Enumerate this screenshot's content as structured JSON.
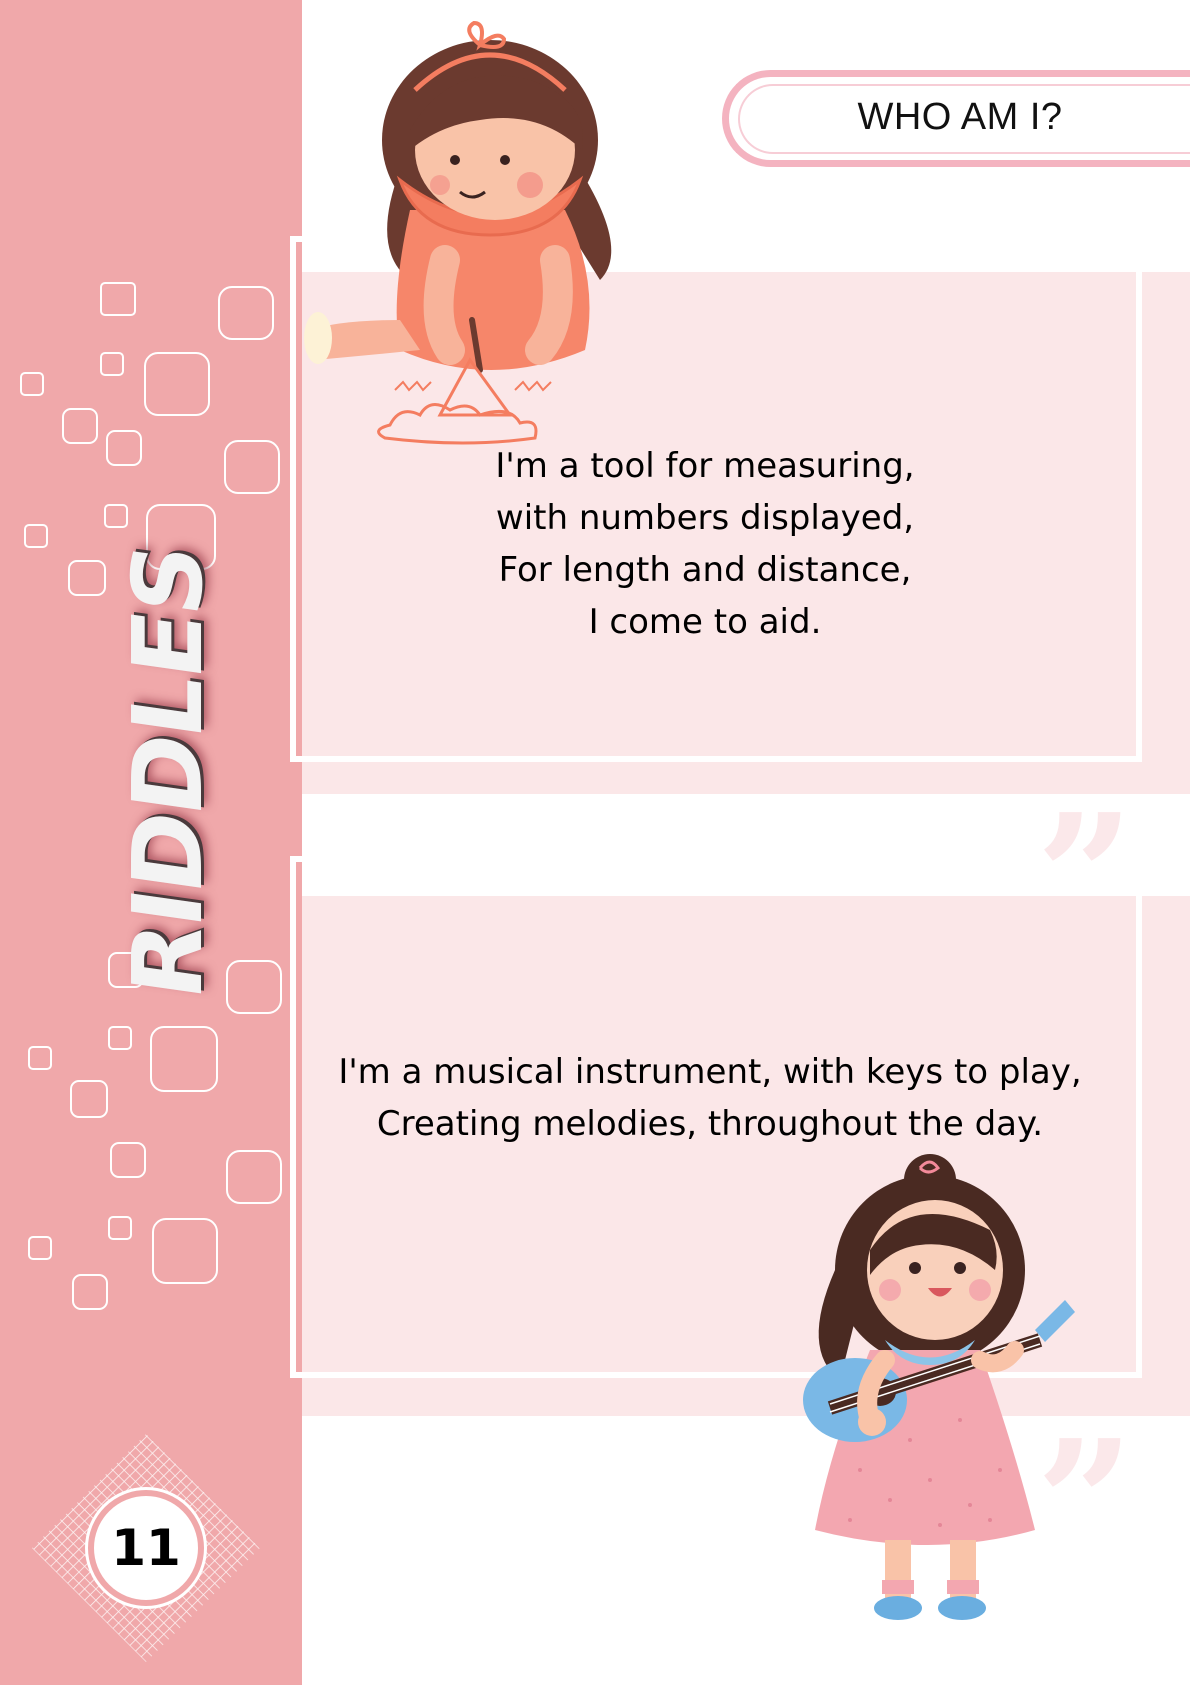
{
  "sidebar": {
    "title": "RIDDLES",
    "page_number": "11",
    "color": "#f0a8aa"
  },
  "header": {
    "label": "WHO AM I?",
    "accent": "#f4b3c0"
  },
  "riddles": [
    {
      "text": "I'm a tool for measuring,\n with numbers displayed,\nFor length and distance,\n I come to aid."
    },
    {
      "text": "I'm a musical instrument, with keys to play,\nCreating melodies, throughout the day."
    }
  ],
  "illustrations": {
    "top": "girl-drawing-icon",
    "bottom": "girl-with-ukulele-icon"
  }
}
